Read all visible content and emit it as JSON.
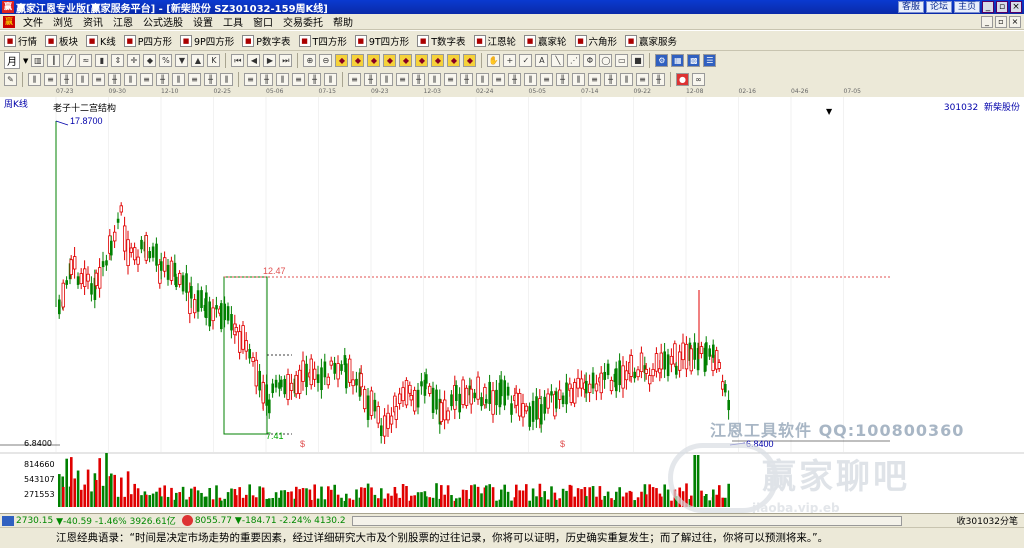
{
  "window": {
    "app_icon": "赢",
    "title": "赢家江恩专业版[赢家服务平台] - [新柴股份  SZ301032-159周K线]",
    "links": [
      "客服",
      "论坛",
      "主页"
    ],
    "controls": [
      "_",
      "▫",
      "×"
    ]
  },
  "menu": {
    "logo": "赢",
    "items": [
      "文件",
      "浏览",
      "资讯",
      "江恩",
      "公式选股",
      "设置",
      "工具",
      "窗口",
      "交易委托",
      "帮助"
    ],
    "controls": [
      "_",
      "▫",
      "×"
    ]
  },
  "toolbar1": {
    "items": [
      {
        "icon": "grid-icon",
        "label": "行情"
      },
      {
        "icon": "block-icon",
        "label": "板块"
      },
      {
        "icon": "kline-icon",
        "label": "K线"
      },
      {
        "icon": "p-square-icon",
        "label": "P四方形"
      },
      {
        "icon": "9p-square-icon",
        "label": "9P四方形"
      },
      {
        "icon": "p-table-icon",
        "label": "P数字表"
      },
      {
        "icon": "t-square-icon",
        "label": "T四方形"
      },
      {
        "icon": "9t-square-icon",
        "label": "9T四方形"
      },
      {
        "icon": "t-table-icon",
        "label": "T数字表"
      },
      {
        "icon": "gann-wheel-icon",
        "label": "江恩轮"
      },
      {
        "icon": "winner-wheel-icon",
        "label": "赢家轮"
      },
      {
        "icon": "hexagon-icon",
        "label": "六角形"
      },
      {
        "icon": "service-icon",
        "label": "赢家服务"
      }
    ]
  },
  "toolbar2": {
    "period_selector": "月",
    "icons": [
      "candle",
      "bar",
      "line",
      "ma",
      "vol",
      "hl",
      "cross",
      "close",
      "ratio",
      "bear",
      "bull",
      "k",
      "first",
      "prev",
      "next",
      "last",
      "zoom",
      "zoomout",
      "diamond1",
      "diamond2",
      "diamond3",
      "diamond4",
      "diamond5",
      "diamond6",
      "diamond7",
      "diamond8",
      "diamond9",
      "hand",
      "plus",
      "check",
      "text",
      "trend",
      "fan",
      "fib",
      "cycle",
      "box",
      "square",
      "gear",
      "grid",
      "mesh",
      "list"
    ]
  },
  "toolbar3": {
    "icons": [
      "pen",
      "tick1",
      "tick2",
      "tick3",
      "tick4",
      "tick5",
      "tick6",
      "tick7",
      "tick8",
      "tick9",
      "tick10",
      "tick11",
      "tick12",
      "tick13",
      "tick14",
      "tick15",
      "tick16",
      "tick17",
      "tick18",
      "tick19",
      "tick20",
      "tick21",
      "tick22",
      "tick23",
      "tick24",
      "tick25",
      "tick26",
      "tick27",
      "tick28",
      "tick29",
      "tick30",
      "tick31",
      "tick32",
      "tick33",
      "tick34",
      "tick35",
      "tick36",
      "tick37",
      "tick38",
      "tick39",
      "circle",
      "wave"
    ]
  },
  "date_ticks": [
    "07-23",
    "09-30",
    "12-10",
    "02-25",
    "05-06",
    "07-15",
    "09-23",
    "12-03",
    "02-24",
    "05-05",
    "07-14",
    "09-22",
    "12-08",
    "02-16",
    "04-26",
    "07-05"
  ],
  "chart": {
    "period_label": "周K线",
    "structure_label": "老子十二宫结构",
    "stock_code": "301032",
    "stock_name": "新柴股份",
    "high_marker": "17.8700",
    "low_marker": "6.8400",
    "box_top": "12.47",
    "box_bottom": "7.41",
    "min_axis": "6.8400",
    "dollar_marks": [
      "$",
      "$"
    ],
    "volume_axis": [
      "814660",
      "543107",
      "271553"
    ],
    "watermark_text": "江恩工具软件   QQ:100800360",
    "watermark_brand": "赢家聊吧",
    "watermark_url": "jiaoba.vip.eb"
  },
  "colors": {
    "up": "#e00000",
    "down": "#008000",
    "accent": "#0a2aa8"
  },
  "status": {
    "sh_index": "2730.15",
    "sh_change": "▼-40.59 -1.46% 3926.61亿",
    "sz_index": "8055.77",
    "sz_change": "▼-184.71 -2.24% 4130.2",
    "right_text": "收301032分笔"
  },
  "quote": "江恩经典语录：“时间是决定市场走势的重要因素，经过详细研究大市及个别股票的过往记录，你将可以证明，历史确实重复发生；而了解过往，你将可以预测将来。”。"
}
